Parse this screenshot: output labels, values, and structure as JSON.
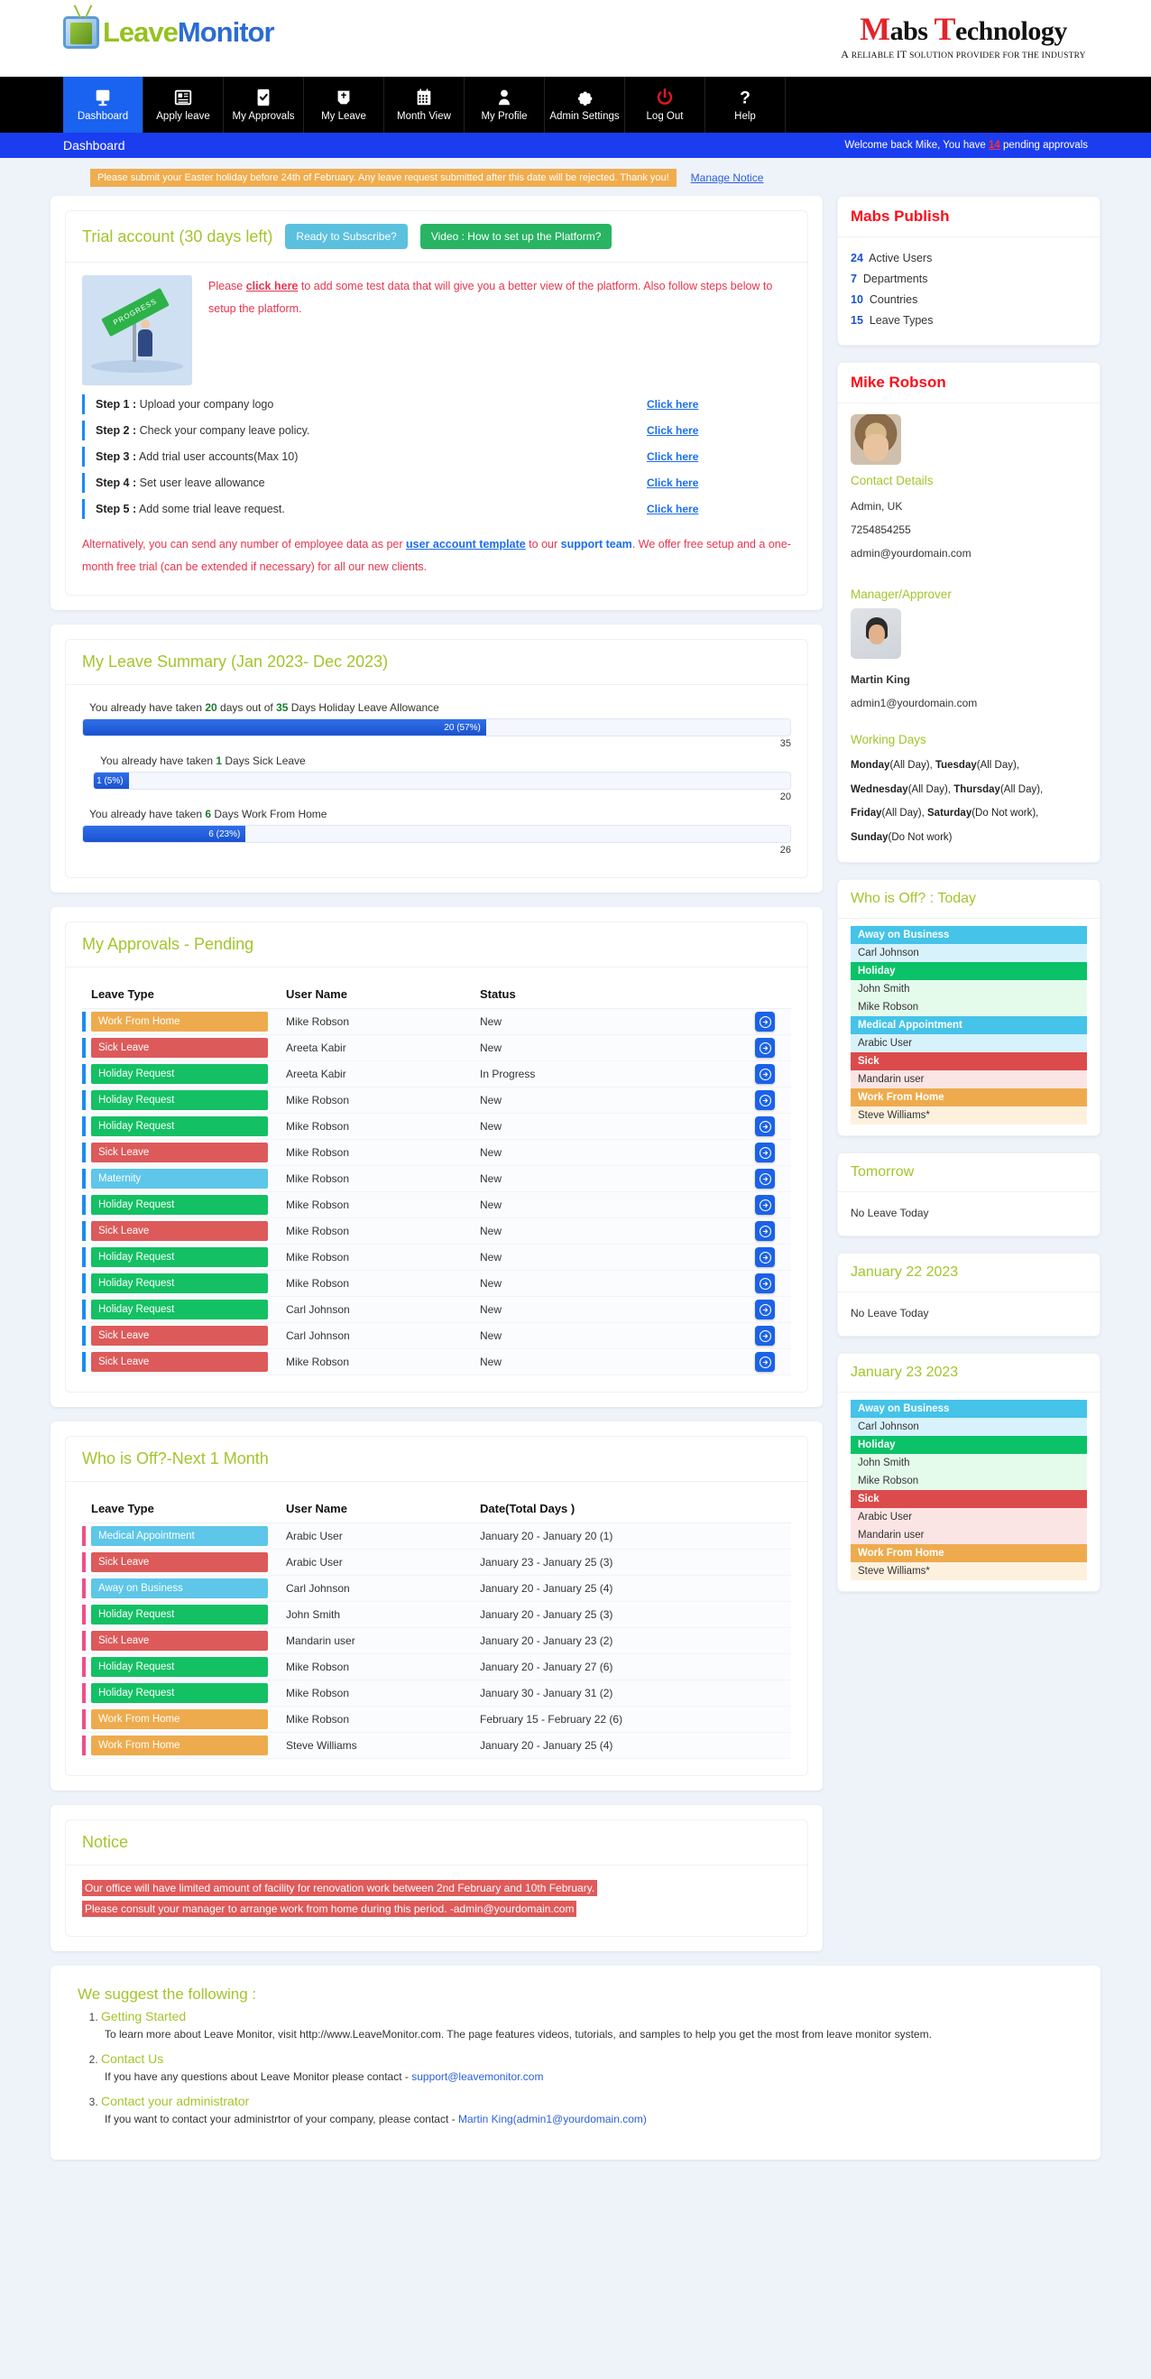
{
  "brand": {
    "app_name_1": "Leave",
    "app_name_2": "Monitor",
    "corp_m": "M",
    "corp_abs": "abs ",
    "corp_t": "T",
    "corp_echnology": "echnology",
    "corp_tagline_a": "A",
    "corp_tagline_b": " RELIABLE ",
    "corp_tagline_it": "IT",
    "corp_tagline_c": " SOLUTION PROVIDER FOR THE INDUSTRY"
  },
  "nav": {
    "items": [
      {
        "label": "Dashboard",
        "icon": "monitor-icon",
        "active": true
      },
      {
        "label": "Apply leave",
        "icon": "newspaper-icon",
        "active": false
      },
      {
        "label": "My Approvals",
        "icon": "check-document-icon",
        "active": false
      },
      {
        "label": "My Leave",
        "icon": "inbox-icon",
        "active": false
      },
      {
        "label": "Month View",
        "icon": "calendar-icon",
        "active": false
      },
      {
        "label": "My Profile",
        "icon": "person-icon",
        "active": false
      },
      {
        "label": "Admin Settings",
        "icon": "gear-icon",
        "active": false
      },
      {
        "label": "Log Out",
        "icon": "power-icon",
        "active": false
      },
      {
        "label": "Help",
        "icon": "question-mark-icon",
        "active": false
      }
    ]
  },
  "titlebar": {
    "page_title": "Dashboard",
    "welcome_prefix": "Welcome back Mike,  You have ",
    "pending_count": "14",
    "welcome_suffix": " pending approvals"
  },
  "notice_strip": {
    "message": "Please submit your Easter holiday before 24th of February. Any leave request submitted after this date will be rejected. Thank you!",
    "manage_link": "Manage Notice"
  },
  "trial": {
    "title": "Trial account (30 days left)",
    "subscribe_button": "Ready to Subscribe?",
    "video_button": "Video : How to set up the Platform?",
    "image_sign_text": "PROGRESS",
    "intro_pre": "Please ",
    "intro_link": "click here",
    "intro_post": " to add some test data that will give you a better view of the platform. Also follow steps below to setup the platform.",
    "steps": [
      {
        "num": "Step 1 :",
        "text": "Upload your company logo",
        "link": "Click here"
      },
      {
        "num": "Step 2 :",
        "text": "Check your company leave policy.",
        "link": "Click here"
      },
      {
        "num": "Step 3 :",
        "text": "Add trial user accounts(Max 10)",
        "link": "Click here"
      },
      {
        "num": "Step 4 :",
        "text": "Set user leave allowance",
        "link": "Click here"
      },
      {
        "num": "Step 5 :",
        "text": "Add some trial leave request.",
        "link": "Click here"
      }
    ],
    "alt_a": "Alternatively, you can send any number of employee data as per ",
    "alt_link": "user account template",
    "alt_b": " to our ",
    "alt_bold": "support team",
    "alt_c": ". We offer free setup and a one-month free trial (can be extended if necessary) for all our new clients."
  },
  "leave_summary": {
    "title": "My Leave Summary (Jan 2023- Dec 2023)",
    "rows": [
      {
        "pre": "You already have taken ",
        "taken": "20",
        "mid": " days out of ",
        "allow": "35",
        "post": " Days Holiday Leave Allowance",
        "bar_label": "20 (57%)",
        "percent": 57,
        "max_label": "35",
        "indent": false
      },
      {
        "pre": "You already have taken ",
        "taken": "1",
        "mid": "",
        "allow": "",
        "post": " Days Sick Leave",
        "bar_label": "1 (5%)",
        "percent": 5,
        "max_label": "20",
        "indent": true
      },
      {
        "pre": "You already have taken ",
        "taken": "6",
        "mid": "",
        "allow": "",
        "post": " Days Work From Home",
        "bar_label": "6 (23%)",
        "percent": 23,
        "max_label": "26",
        "indent": false
      }
    ]
  },
  "approvals": {
    "title": "My Approvals - Pending",
    "columns": [
      "Leave Type",
      "User Name",
      "Status",
      ""
    ],
    "rows": [
      {
        "type": "Work From Home",
        "color": "#eeab4e",
        "user": "Mike Robson",
        "status": "New"
      },
      {
        "type": "Sick Leave",
        "color": "#dd5a5a",
        "user": "Areeta Kabir",
        "status": "New"
      },
      {
        "type": "Holiday Request",
        "color": "#14c064",
        "user": "Areeta Kabir",
        "status": "In Progress"
      },
      {
        "type": "Holiday Request",
        "color": "#14c064",
        "user": "Mike Robson",
        "status": "New"
      },
      {
        "type": "Holiday Request",
        "color": "#14c064",
        "user": "Mike Robson",
        "status": "New"
      },
      {
        "type": "Sick Leave",
        "color": "#dd5a5a",
        "user": "Mike Robson",
        "status": "New"
      },
      {
        "type": "Maternity",
        "color": "#5ec6e8",
        "user": "Mike Robson",
        "status": "New"
      },
      {
        "type": "Holiday Request",
        "color": "#14c064",
        "user": "Mike Robson",
        "status": "New"
      },
      {
        "type": "Sick Leave",
        "color": "#dd5a5a",
        "user": "Mike Robson",
        "status": "New"
      },
      {
        "type": "Holiday Request",
        "color": "#14c064",
        "user": "Mike Robson",
        "status": "New"
      },
      {
        "type": "Holiday Request",
        "color": "#14c064",
        "user": "Mike Robson",
        "status": "New"
      },
      {
        "type": "Holiday Request",
        "color": "#14c064",
        "user": "Carl Johnson",
        "status": "New"
      },
      {
        "type": "Sick Leave",
        "color": "#dd5a5a",
        "user": "Carl Johnson",
        "status": "New"
      },
      {
        "type": "Sick Leave",
        "color": "#dd5a5a",
        "user": "Mike Robson",
        "status": "New"
      }
    ],
    "go_icon": "arrow-right-circle-icon"
  },
  "whoisoff_month": {
    "title": "Who is Off?-Next 1 Month",
    "columns": [
      "Leave Type",
      "User Name",
      "Date(Total Days )"
    ],
    "rows": [
      {
        "type": "Medical Appointment",
        "color": "#5ec6e8",
        "user": "Arabic   User",
        "date": "January 20 - January 20 (1)"
      },
      {
        "type": "Sick Leave",
        "color": "#dd5a5a",
        "user": "Arabic   User",
        "date": "January 23 - January 25 (3)"
      },
      {
        "type": "Away on Business",
        "color": "#5ec6e8",
        "user": "Carl   Johnson",
        "date": "January 20 - January 25 (4)"
      },
      {
        "type": "Holiday Request",
        "color": "#14c064",
        "user": "John   Smith",
        "date": "January 20 - January 25 (3)"
      },
      {
        "type": "Sick Leave",
        "color": "#dd5a5a",
        "user": "Mandarin   user",
        "date": "January 20 - January 23 (2)"
      },
      {
        "type": "Holiday Request",
        "color": "#14c064",
        "user": "Mike   Robson",
        "date": "January 20 - January 27 (6)"
      },
      {
        "type": "Holiday Request",
        "color": "#14c064",
        "user": "Mike   Robson",
        "date": "January 30 - January 31 (2)"
      },
      {
        "type": "Work From Home",
        "color": "#eeab4e",
        "user": "Mike   Robson",
        "date": "February 15 - February 22 (6)"
      },
      {
        "type": "Work From Home",
        "color": "#eeab4e",
        "user": "Steve   Williams",
        "date": "January 20 - January 25 (4)"
      }
    ]
  },
  "notice_panel": {
    "title": "Notice",
    "line1": "Our office will have limited amount of facility for renovation work between 2nd February and 10th February.",
    "line2": "Please consult your manager to arrange work from home during this period. -admin@yourdomain.com"
  },
  "suggest": {
    "title": "We suggest the following :",
    "items": [
      {
        "head": "Getting Started",
        "body": "To learn more about Leave Monitor, visit http://www.LeaveMonitor.com. The page features videos, tutorials, and samples to help you get the most from leave monitor system."
      },
      {
        "head": "Contact Us",
        "body_pre": "If you have any questions about Leave Monitor please contact - ",
        "body_link": "support@leavemonitor.com"
      },
      {
        "head": "Contact your administrator",
        "body_pre": "If you want to contact your administrtor of your company, please contact - ",
        "body_link": "Martin King(admin1@yourdomain.com)"
      }
    ]
  },
  "sidebar": {
    "publish": {
      "title": "Mabs Publish",
      "stats": [
        {
          "value": "24",
          "label": "Active Users"
        },
        {
          "value": "7",
          "label": "Departments"
        },
        {
          "value": "10",
          "label": "Countries"
        },
        {
          "value": "15",
          "label": "Leave Types"
        }
      ]
    },
    "profile": {
      "name": "Mike Robson",
      "contact_label": "Contact Details",
      "role": "Admin, UK",
      "phone": "7254854255",
      "email": "admin@yourdomain.com",
      "manager_label": "Manager/Approver",
      "manager_name": "Martin King",
      "manager_email": "admin1@yourdomain.com",
      "working_days_label": "Working Days",
      "working_days": [
        {
          "day": "Monday",
          "note": "(All Day), "
        },
        {
          "day": "Tuesday",
          "note": "(All Day), "
        },
        {
          "day": "Wednesday",
          "note": "(All Day), "
        },
        {
          "day": "Thursday",
          "note": "(All Day), "
        },
        {
          "day": "Friday",
          "note": "(All Day), "
        },
        {
          "day": "Saturday",
          "note": "(Do Not work), "
        },
        {
          "day": "Sunday",
          "note": "(Do Not work)"
        }
      ]
    },
    "whoisoff_today": {
      "title": "Who is Off?  : Today",
      "groups": [
        {
          "tag": "Away on Business",
          "color": "#45c3e8",
          "tint": "#d8f2fb",
          "names": [
            "Carl Johnson"
          ]
        },
        {
          "tag": "Holiday",
          "color": "#0bc268",
          "tint": "#e4fbec",
          "names": [
            "John Smith",
            "Mike Robson"
          ]
        },
        {
          "tag": "Medical Appointment",
          "color": "#45c3e8",
          "tint": "#d8f2fb",
          "names": [
            "Arabic User"
          ]
        },
        {
          "tag": "Sick",
          "color": "#dc4b4b",
          "tint": "#fbe4e4",
          "names": [
            "Mandarin user"
          ]
        },
        {
          "tag": "Work From Home",
          "color": "#eeab4e",
          "tint": "#fdf1de",
          "names": [
            "Steve Williams*"
          ]
        }
      ]
    },
    "tomorrow": {
      "title": "Tomorrow",
      "empty_text": "No Leave Today"
    },
    "jan22": {
      "title": "January 22 2023",
      "empty_text": "No Leave Today"
    },
    "jan23": {
      "title": "January 23 2023",
      "groups": [
        {
          "tag": "Away on Business",
          "color": "#45c3e8",
          "tint": "#d8f2fb",
          "names": [
            "Carl Johnson"
          ]
        },
        {
          "tag": "Holiday",
          "color": "#0bc268",
          "tint": "#e4fbec",
          "names": [
            "John Smith",
            "Mike Robson"
          ]
        },
        {
          "tag": "Sick",
          "color": "#dc4b4b",
          "tint": "#fbe4e4",
          "names": [
            "Arabic User",
            "Mandarin user"
          ]
        },
        {
          "tag": "Work From Home",
          "color": "#eeab4e",
          "tint": "#fdf1de",
          "names": [
            "Steve Williams*"
          ]
        }
      ]
    }
  }
}
